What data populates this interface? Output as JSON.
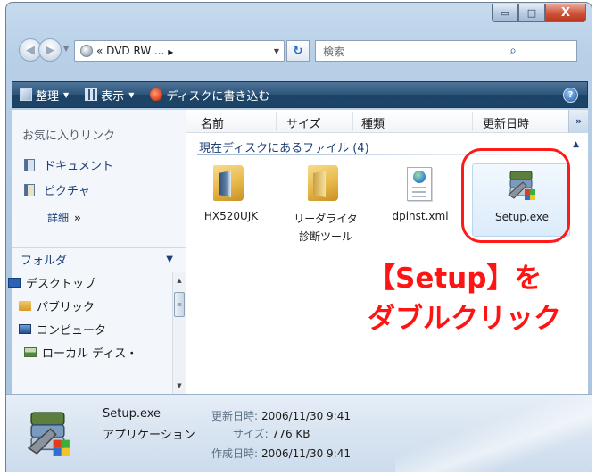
{
  "window": {
    "caption_buttons": {
      "minimize_glyph": "▭",
      "maximize_glyph": "□",
      "close_glyph": "X"
    }
  },
  "address": {
    "back_glyph": "◀",
    "forward_glyph": "▶",
    "dropdown_glyph": "▼",
    "prefix": "«",
    "path": "DVD RW ...",
    "crumb_arrow": "▶",
    "history_arrow": "▼",
    "refresh_glyph": "↻",
    "search_placeholder": "検索",
    "search_glyph": "⌕"
  },
  "commandbar": {
    "items": [
      {
        "label": "整理",
        "icon": "organize-icon"
      },
      {
        "label": "表示",
        "icon": "views-icon"
      },
      {
        "label": "ディスクに書き込む",
        "icon": "burn-disc-icon"
      }
    ],
    "caret": "▼",
    "help_glyph": "?"
  },
  "navpane": {
    "favorites_header": "お気に入りリンク",
    "favorites": [
      {
        "label": "ドキュメント",
        "icon": "documents-icon"
      },
      {
        "label": "ピクチャ",
        "icon": "pictures-icon"
      }
    ],
    "more_label": "詳細",
    "more_glyph": "»",
    "folders_header": "フォルダ",
    "folders_caret": "▼",
    "tree": [
      {
        "label": "デスクトップ",
        "icon": "desktop-icon"
      },
      {
        "label": "パブリック",
        "icon": "public-folder-icon"
      },
      {
        "label": "コンピュータ",
        "icon": "computer-icon"
      },
      {
        "label": "ローカル ディス・",
        "icon": "local-disk-icon"
      }
    ],
    "scroll_up": "▲",
    "scroll_down": "▼",
    "scroll_thumb": "≡"
  },
  "content": {
    "columns": [
      "名前",
      "サイズ",
      "種類",
      "更新日時"
    ],
    "more_columns": "»",
    "group_header": "現在ディスクにあるファイル (4)",
    "group_caret": "▲",
    "files": [
      {
        "label": "HX520UJK",
        "type": "folder"
      },
      {
        "label": "リーダライタ\n診断ツール",
        "type": "folder"
      },
      {
        "label": "dpinst.xml",
        "type": "xml"
      },
      {
        "label": "Setup.exe",
        "type": "application"
      }
    ]
  },
  "annotation": {
    "line1": "【Setup】を",
    "line2": "ダブルクリック",
    "color": "#ff1414"
  },
  "details": {
    "name": "Setup.exe",
    "type": "アプリケーション",
    "modified_label": "更新日時:",
    "modified_value": "2006/11/30 9:41",
    "size_label": "サイズ:",
    "size_value": "776 KB",
    "created_label": "作成日時:",
    "created_value": "2006/11/30 9:41"
  }
}
